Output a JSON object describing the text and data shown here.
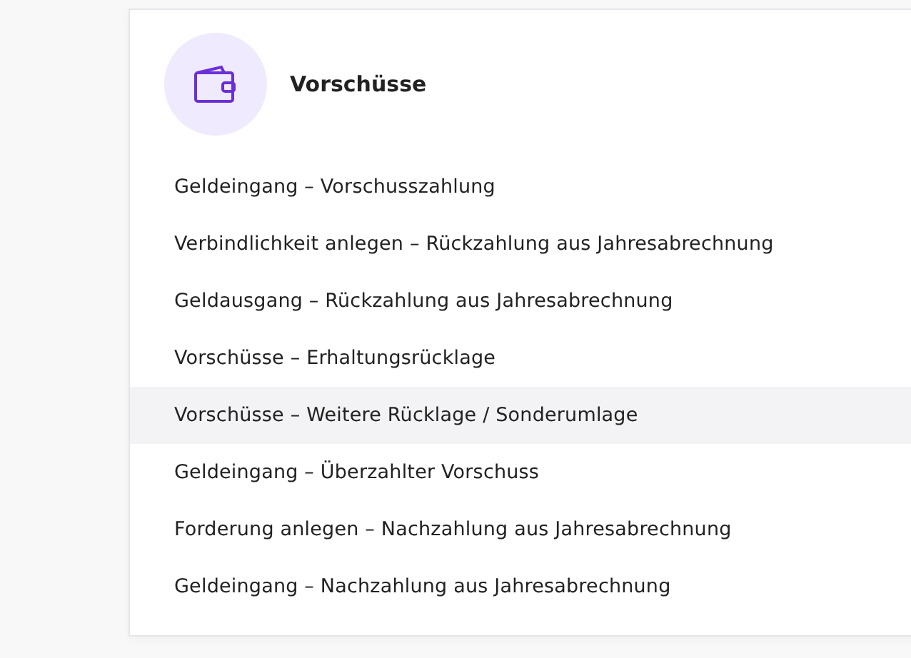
{
  "card": {
    "title": "Vorschüsse",
    "items": [
      {
        "label": "Geldeingang – Vorschusszahlung",
        "selected": false
      },
      {
        "label": "Verbindlichkeit anlegen – Rückzahlung aus Jahresabrechnung",
        "selected": false
      },
      {
        "label": "Geldausgang – Rückzahlung aus Jahresabrechnung",
        "selected": false
      },
      {
        "label": "Vorschüsse – Erhaltungsrücklage",
        "selected": false
      },
      {
        "label": "Vorschüsse – Weitere Rücklage / Sonderumlage",
        "selected": true
      },
      {
        "label": "Geldeingang – Überzahlter Vorschuss",
        "selected": false
      },
      {
        "label": "Forderung anlegen – Nachzahlung aus Jahresabrechnung",
        "selected": false
      },
      {
        "label": "Geldeingang – Nachzahlung aus Jahresabrechnung",
        "selected": false
      }
    ]
  }
}
